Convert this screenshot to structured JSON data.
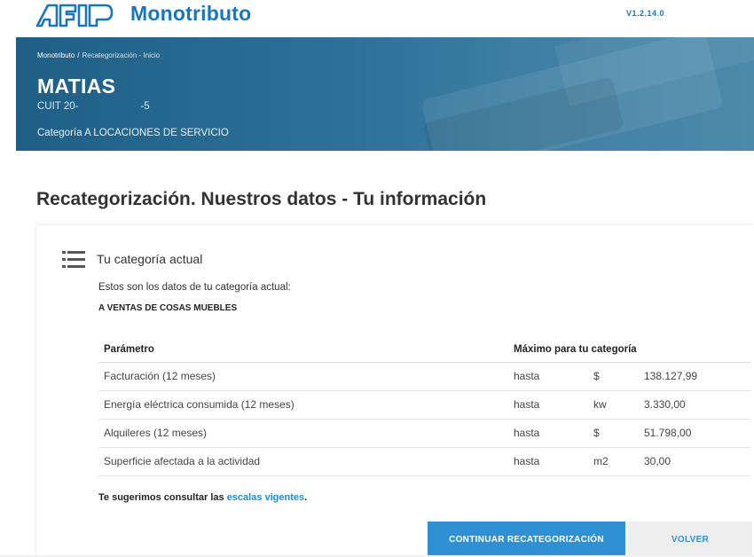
{
  "header": {
    "logo_text": "AFIP",
    "brand": "Monotributo",
    "version": "V1.2.14.0"
  },
  "banner": {
    "breadcrumb_home": "Monotributo",
    "breadcrumb_sep": "/",
    "breadcrumb_current": "Recategorización - Inicio",
    "name": "MATIAS",
    "cuit_prefix": "CUIT 20-",
    "cuit_suffix": "-5",
    "category": "Categoría A LOCACIONES DE SERVICIO"
  },
  "page_title": "Recategorización. Nuestros datos - Tu información",
  "card": {
    "title": "Tu categoría actual",
    "description": "Estos son los datos de tu categoría actual:",
    "category_name": "A VENTAS DE COSAS MUEBLES",
    "table": {
      "headers": [
        "Parámetro",
        "Máximo para tu categoría"
      ],
      "rows": [
        {
          "param": "Facturación (12 meses)",
          "limit": "hasta",
          "unit": "$",
          "value": "138.127,99"
        },
        {
          "param": "Energía eléctrica consumida (12 meses)",
          "limit": "hasta",
          "unit": "kw",
          "value": "3.330,00"
        },
        {
          "param": "Alquileres (12 meses)",
          "limit": "hasta",
          "unit": "$",
          "value": "51.798,00"
        },
        {
          "param": "Superficie afectada a la actividad",
          "limit": "hasta",
          "unit": "m2",
          "value": "30,00"
        }
      ]
    },
    "note_prefix": "Te sugerimos consultar las ",
    "note_link": "escalas vigentes",
    "note_suffix": ".",
    "continue_label": "CONTINUAR RECATEGORIZACIÓN",
    "back_label": "VOLVER"
  },
  "colors": {
    "brand_blue": "#1a75bb",
    "banner_blue": "#2d7199",
    "button_blue": "#2f91d4",
    "link_blue": "#1a8cd8"
  },
  "icons": [
    "afip-logo-icon",
    "list-icon"
  ]
}
